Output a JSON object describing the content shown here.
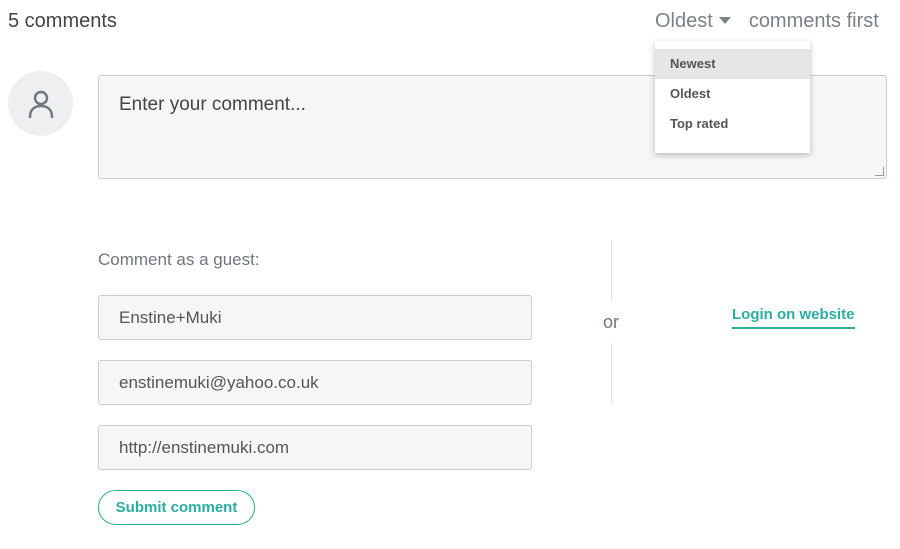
{
  "header": {
    "comment_count": "5 comments",
    "sort_selected": "Oldest",
    "sort_suffix": "comments first"
  },
  "sort_menu": {
    "options": [
      "Newest",
      "Oldest",
      "Top rated"
    ],
    "highlighted": "Newest"
  },
  "comment_input": {
    "placeholder": "Enter your comment..."
  },
  "guest_form": {
    "label": "Comment as a guest:",
    "name_value": "Enstine+Muki",
    "email_value": "enstinemuki@yahoo.co.uk",
    "website_value": "http://enstinemuki.com",
    "submit_label": "Submit comment"
  },
  "alt_login": {
    "or_text": "or",
    "login_label": "Login on website"
  },
  "icons": {
    "avatar": "user-icon",
    "sort_caret": "caret-down-icon",
    "resize": "resize-grip-icon"
  },
  "colors": {
    "accent": "#2aaea0",
    "muted_text": "#7a8288",
    "field_bg": "#f5f6f7"
  }
}
